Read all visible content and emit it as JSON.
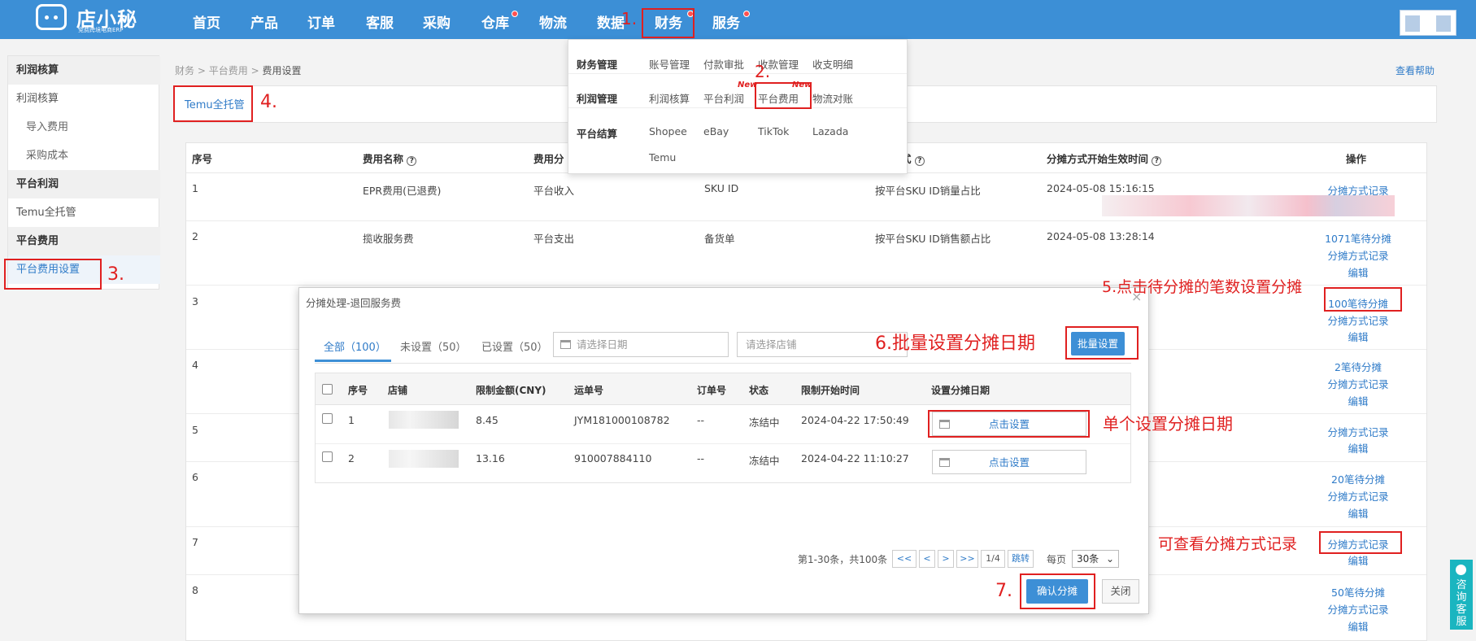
{
  "brand": {
    "name": "店小秘",
    "tagline": "免费跨境电商ERP"
  },
  "nav": [
    {
      "label": "首页"
    },
    {
      "label": "产品"
    },
    {
      "label": "订单"
    },
    {
      "label": "客服"
    },
    {
      "label": "采购"
    },
    {
      "label": "仓库"
    },
    {
      "label": "物流"
    },
    {
      "label": "数据"
    },
    {
      "label": "财务"
    },
    {
      "label": "服务"
    }
  ],
  "finance_menu": {
    "groups": [
      {
        "title": "财务管理",
        "items": [
          "账号管理",
          "付款审批",
          "收款管理",
          "收支明细"
        ]
      },
      {
        "title": "利润管理",
        "items": [
          "利润核算",
          "平台利润",
          "平台费用",
          "物流对账"
        ],
        "new_tag": "New"
      },
      {
        "title": "平台结算",
        "items": [
          "Shopee",
          "eBay",
          "TikTok",
          "Lazada",
          "Temu"
        ]
      }
    ]
  },
  "sidebar": {
    "sections": [
      {
        "title": "利润核算",
        "items": [
          "利润核算",
          "导入费用",
          "采购成本"
        ]
      },
      {
        "title": "平台利润",
        "items": [
          "Temu全托管"
        ]
      },
      {
        "title": "平台费用",
        "items": [
          "平台费用设置"
        ]
      }
    ]
  },
  "breadcrumb": {
    "part1": "财务",
    "sep": ">",
    "part2": "平台费用",
    "part3": "费用设置"
  },
  "help_link": "查看帮助",
  "tab_label": "Temu全托管",
  "table": {
    "headers": [
      "序号",
      "费用名称",
      "费用分",
      "式",
      "分摊方式开始生效时间",
      "操作"
    ],
    "rows": [
      {
        "no": "1",
        "name": "EPR费用(已退费)",
        "category": "平台收入",
        "dim": "SKU ID",
        "method": "按平台SKU ID销量占比",
        "time": "2024-05-08 15:16:15",
        "ops": [
          "分摊方式记录"
        ]
      },
      {
        "no": "2",
        "name": "揽收服务费",
        "category": "平台支出",
        "dim": "备货单",
        "method": "按平台SKU ID销售额占比",
        "time": "2024-05-08 13:28:14",
        "ops": [
          "1071笔待分摊",
          "分摊方式记录",
          "编辑"
        ]
      },
      {
        "no": "3",
        "ops": [
          "100笔待分摊",
          "分摊方式记录",
          "编辑"
        ]
      },
      {
        "no": "4",
        "ops": [
          "2笔待分摊",
          "分摊方式记录",
          "编辑"
        ]
      },
      {
        "no": "5",
        "ops": [
          "分摊方式记录",
          "编辑"
        ]
      },
      {
        "no": "6",
        "ops": [
          "20笔待分摊",
          "分摊方式记录",
          "编辑"
        ]
      },
      {
        "no": "7",
        "ops": [
          "分摊方式记录",
          "编辑"
        ]
      },
      {
        "no": "8",
        "ops": [
          "50笔待分摊",
          "分摊方式记录",
          "编辑"
        ]
      }
    ]
  },
  "modal": {
    "title": "分摊处理-退回服务费",
    "close": "×",
    "tabs": [
      "全部（100）",
      "未设置（50）",
      "已设置（50）"
    ],
    "date_placeholder": "请选择日期",
    "store_placeholder": "请选择店铺",
    "batch_button": "批量设置",
    "headers": [
      "序号",
      "店铺",
      "限制金额(CNY)",
      "运单号",
      "订单号",
      "状态",
      "限制开始时间",
      "设置分摊日期"
    ],
    "rows": [
      {
        "no": "1",
        "amount": "8.45",
        "waybill": "JYM181000108782",
        "order": "--",
        "status": "冻结中",
        "start": "2024-04-22 17:50:49",
        "action": "点击设置"
      },
      {
        "no": "2",
        "amount": "13.16",
        "waybill": "910007884110",
        "order": "--",
        "status": "冻结中",
        "start": "2024-04-22 11:10:27",
        "action": "点击设置"
      }
    ],
    "pager": {
      "summary": "第1-30条，共100条",
      "first": "<<",
      "prev": "<",
      "next": ">",
      "last": ">>",
      "page": "1/4",
      "jump": "跳转",
      "per_page_label": "每页",
      "per_page": "30条"
    },
    "confirm_button": "确认分摊",
    "cancel_button": "关闭"
  },
  "annotations": {
    "a1": "1.",
    "a2": "2.",
    "a3": "3.",
    "a4": "4.",
    "a5": "5.点击待分摊的笔数设置分摊",
    "a6": "6.批量设置分摊日期",
    "a7": "7.",
    "single": "单个设置分摊日期",
    "view": "可查看分摊方式记录"
  },
  "consult": "咨询客服",
  "colors": {
    "primary": "#3c8fd6",
    "link": "#2f7bc8",
    "annotation": "#e02020"
  }
}
